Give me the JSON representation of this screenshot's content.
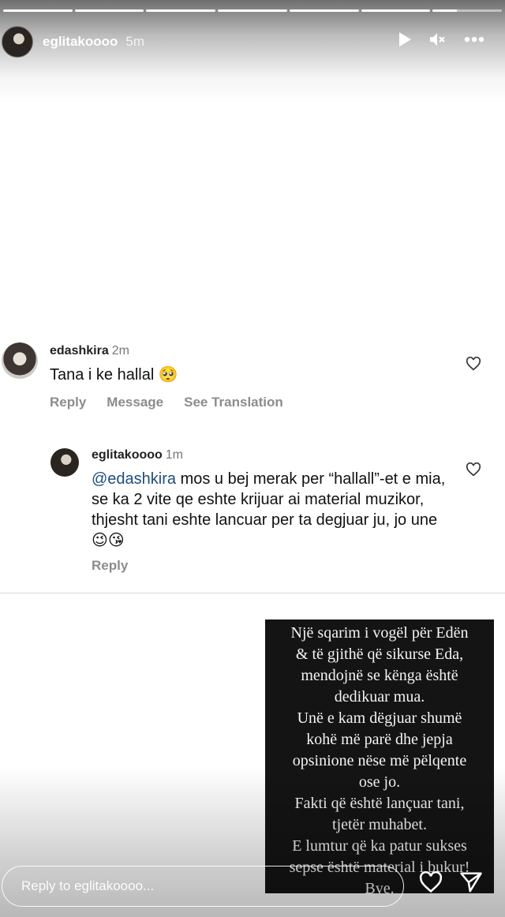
{
  "story": {
    "progress_segments": [
      1,
      1,
      1,
      1,
      1,
      1,
      0.35
    ],
    "username": "eglitakoooo",
    "time": "5m"
  },
  "comments": [
    {
      "username": "edashkira",
      "time": "2m",
      "text": "Tana i ke hallal 🥺",
      "actions": [
        "Reply",
        "Message",
        "See Translation"
      ]
    },
    {
      "username": "eglitakoooo",
      "time": "1m",
      "mention": "@edashkira",
      "text": " mos u bej merak per “hallall”-et e mia, se ka 2 vite qe eshte krijuar ai material muzikor, thjesht tani eshte lancuar per ta degjuar ju, jo une😉😘",
      "reply_label": "Reply"
    }
  ],
  "note_lines": [
    "Një sqarim i vogël për Edën",
    "& të gjithë që sikurse Eda,",
    "mendojnë se kënga është",
    "dedikuar mua.",
    "Unë e kam dëgjuar shumë",
    "kohë më parë dhe jepja",
    "opsinione nëse më pëlqente",
    "ose jo.",
    "Fakti që është lançuar tani,",
    "tjetër muhabet.",
    "E lumtur që ka patur sukses",
    "sepse është material i bukur!",
    "Bye."
  ],
  "reply_input": {
    "placeholder": "Reply to eglitakoooo...",
    "value": ""
  },
  "icons": {
    "play": "play-icon",
    "mute": "mute-icon",
    "more": "more-icon",
    "like": "heart-icon",
    "send": "send-icon"
  }
}
